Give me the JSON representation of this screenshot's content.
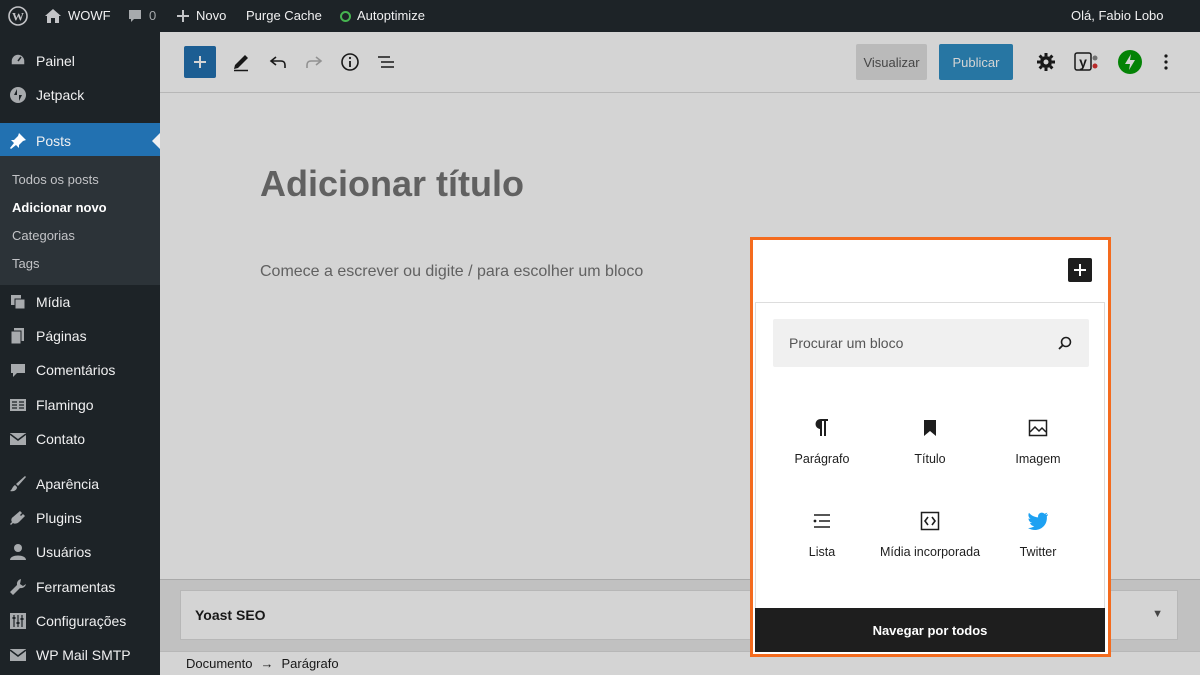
{
  "adminbar": {
    "site_name": "WOWF",
    "comments_count": "0",
    "new_label": "Novo",
    "purge_cache": "Purge Cache",
    "autoptimize": "Autoptimize",
    "greeting": "Olá, Fabio Lobo"
  },
  "sidebar": {
    "items": [
      {
        "label": "Painel",
        "icon": "dashboard-icon"
      },
      {
        "label": "Jetpack",
        "icon": "jetpack-icon"
      },
      {
        "label": "Posts",
        "icon": "pin-icon"
      },
      {
        "label": "Mídia",
        "icon": "media-icon"
      },
      {
        "label": "Páginas",
        "icon": "pages-icon"
      },
      {
        "label": "Comentários",
        "icon": "comments-icon"
      },
      {
        "label": "Flamingo",
        "icon": "flamingo-icon"
      },
      {
        "label": "Contato",
        "icon": "mail-icon"
      },
      {
        "label": "Aparência",
        "icon": "brush-icon"
      },
      {
        "label": "Plugins",
        "icon": "plug-icon"
      },
      {
        "label": "Usuários",
        "icon": "user-icon"
      },
      {
        "label": "Ferramentas",
        "icon": "wrench-icon"
      },
      {
        "label": "Configurações",
        "icon": "settings-icon"
      },
      {
        "label": "WP Mail SMTP",
        "icon": "smtp-icon"
      }
    ],
    "submenu": [
      "Todos os posts",
      "Adicionar novo",
      "Categorias",
      "Tags"
    ]
  },
  "toolbar": {
    "preview": "Visualizar",
    "publish": "Publicar"
  },
  "canvas": {
    "title_placeholder": "Adicionar título",
    "body_placeholder": "Comece a escrever ou digite / para escolher um bloco"
  },
  "metabox": {
    "yoast_title": "Yoast SEO",
    "caret": "▼"
  },
  "breadcrumb": {
    "doc": "Documento",
    "sep": "→",
    "current": "Parágrafo"
  },
  "inserter": {
    "search_placeholder": "Procurar um bloco",
    "blocks": [
      {
        "label": "Parágrafo",
        "icon": "paragraph-icon"
      },
      {
        "label": "Título",
        "icon": "bookmark-icon"
      },
      {
        "label": "Imagem",
        "icon": "image-icon"
      },
      {
        "label": "Lista",
        "icon": "list-icon"
      },
      {
        "label": "Mídia incorporada",
        "icon": "embed-icon"
      },
      {
        "label": "Twitter",
        "icon": "twitter-icon"
      }
    ],
    "browse_all": "Navegar por todos"
  },
  "colors": {
    "accent": "#2271b1",
    "highlight": "#f46b1e",
    "admin_bg": "#1d2327",
    "twitter": "#1da1f2"
  }
}
